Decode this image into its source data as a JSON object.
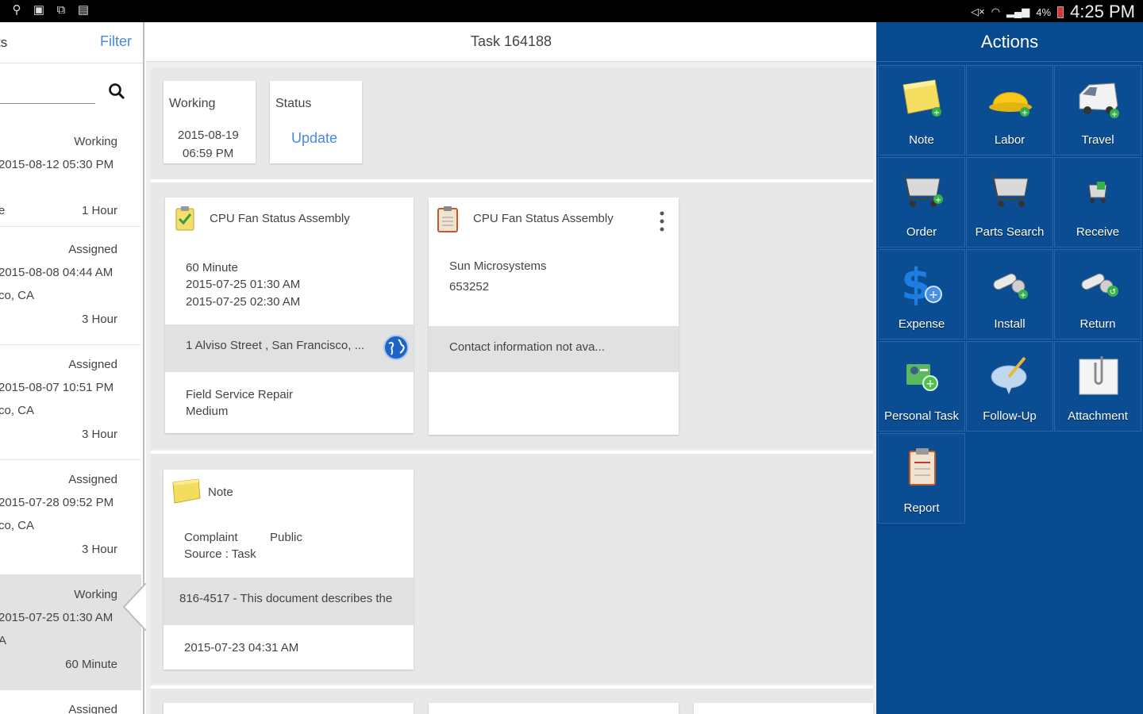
{
  "status_bar": {
    "time": "4:25 PM",
    "battery": "4%"
  },
  "left_panel": {
    "header_left_truncated": "ts",
    "filter_label": "Filter",
    "items": [
      {
        "status": "Working",
        "date": "2015-08-12 05:30 PM",
        "left_frag": "e",
        "duration": "1 Hour"
      },
      {
        "status": "Assigned",
        "date": "2015-08-08 04:44 AM",
        "location_frag": "co, CA",
        "duration": "3 Hour"
      },
      {
        "status": "Assigned",
        "date": "2015-08-07 10:51 PM",
        "location_frag": "co, CA",
        "duration": "3 Hour"
      },
      {
        "status": "Assigned",
        "date": "2015-07-28 09:52 PM",
        "location_frag": "co, CA",
        "duration": "3 Hour"
      },
      {
        "status": "Working",
        "date": "2015-07-25 01:30 AM",
        "location_frag": "A",
        "duration": "60 Minute"
      },
      {
        "status": "Assigned"
      }
    ]
  },
  "center": {
    "title": "Task 164188",
    "working_card": {
      "label": "Working",
      "date": "2015-08-19",
      "time": "06:59 PM"
    },
    "status_card": {
      "label": "Status",
      "action": "Update"
    },
    "assembly_card_1": {
      "title": "CPU Fan Status Assembly",
      "duration": "60 Minute",
      "start": "2015-07-25 01:30 AM",
      "end": "2015-07-25 02:30 AM",
      "address": "1 Alviso Street , San Francisco, ...",
      "type": "Field Service Repair",
      "priority": "Medium"
    },
    "assembly_card_2": {
      "title": "CPU Fan Status Assembly",
      "company": "Sun Microsystems",
      "number": "653252",
      "contact": "Contact information not ava..."
    },
    "note_card": {
      "title": "Note",
      "type": "Complaint",
      "visibility": "Public",
      "source": "Source : Task",
      "description": "816-4517 - This document describes the",
      "date": "2015-07-23 04:31 AM"
    }
  },
  "actions": {
    "title": "Actions",
    "tiles": [
      {
        "label": "Note",
        "icon": "note-icon"
      },
      {
        "label": "Labor",
        "icon": "hardhat-icon"
      },
      {
        "label": "Travel",
        "icon": "van-icon"
      },
      {
        "label": "Order",
        "icon": "cart-icon"
      },
      {
        "label": "Parts Search",
        "icon": "cart-search-icon"
      },
      {
        "label": "Receive",
        "icon": "receive-icon"
      },
      {
        "label": "Expense",
        "icon": "dollar-icon"
      },
      {
        "label": "Install",
        "icon": "install-icon"
      },
      {
        "label": "Return",
        "icon": "return-icon"
      },
      {
        "label": "Personal Task",
        "icon": "personal-task-icon"
      },
      {
        "label": "Follow-Up",
        "icon": "follow-up-icon"
      },
      {
        "label": "Attachment",
        "icon": "attachment-icon"
      },
      {
        "label": "Report",
        "icon": "report-icon"
      }
    ]
  }
}
